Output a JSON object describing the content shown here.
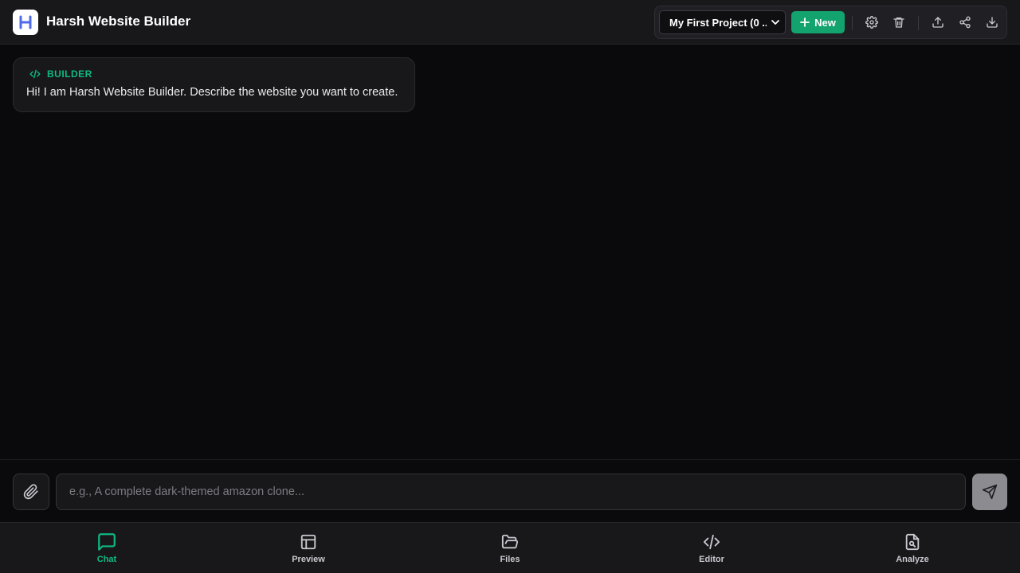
{
  "header": {
    "logo_letter": "H",
    "app_title": "Harsh Website Builder",
    "project_select_value": "My First Project (0 ...",
    "new_button_label": "New"
  },
  "chat": {
    "messages": [
      {
        "role_label": "BUILDER",
        "text": "Hi! I am Harsh Website Builder. Describe the website you want to create."
      }
    ]
  },
  "composer": {
    "placeholder": "e.g., A complete dark-themed amazon clone..."
  },
  "nav": {
    "items": [
      {
        "label": "Chat",
        "icon": "chat-icon",
        "active": true
      },
      {
        "label": "Preview",
        "icon": "layout-icon",
        "active": false
      },
      {
        "label": "Files",
        "icon": "folder-open-icon",
        "active": false
      },
      {
        "label": "Editor",
        "icon": "code-icon",
        "active": false
      },
      {
        "label": "Analyze",
        "icon": "file-search-icon",
        "active": false
      }
    ]
  },
  "colors": {
    "accent": "#10b981",
    "new_button": "#13a36e",
    "logo_letter": "#4f6be8",
    "background": "#0a0a0c",
    "panel": "#18181b"
  }
}
